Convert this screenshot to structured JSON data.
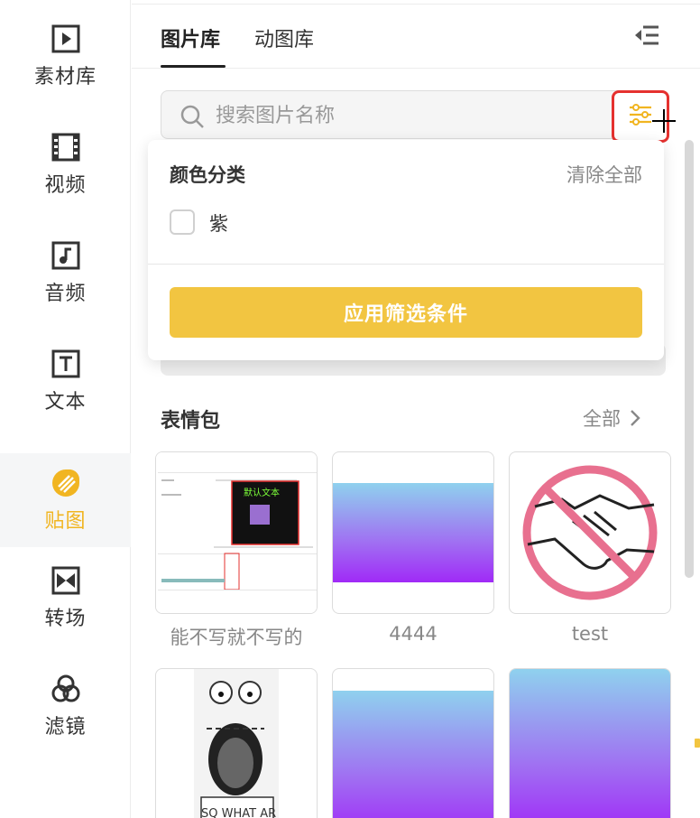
{
  "sidebar": {
    "items": [
      {
        "label": "素材库",
        "icon": "play-square-icon",
        "active": false
      },
      {
        "label": "视频",
        "icon": "film-icon",
        "active": false
      },
      {
        "label": "音频",
        "icon": "music-note-icon",
        "active": false
      },
      {
        "label": "文本",
        "icon": "text-t-icon",
        "active": false
      },
      {
        "label": "贴图",
        "icon": "sticker-icon",
        "active": true
      },
      {
        "label": "转场",
        "icon": "transition-icon",
        "active": false
      },
      {
        "label": "滤镜",
        "icon": "filter-circles-icon",
        "active": false
      }
    ],
    "active_color": "#f1b521"
  },
  "panel": {
    "tabs": [
      {
        "label": "图片库",
        "active": true
      },
      {
        "label": "动图库",
        "active": false
      }
    ],
    "search": {
      "placeholder": "搜索图片名称",
      "value": ""
    },
    "filter_dropdown": {
      "title": "颜色分类",
      "clear_label": "清除全部",
      "options": [
        {
          "label": "紫",
          "checked": false
        }
      ],
      "apply_label": "应用筛选条件",
      "apply_color": "#f2c541"
    },
    "section": {
      "title": "表情包",
      "all_label": "全部"
    },
    "cards": [
      {
        "caption": "能不写就不写的",
        "thumb": "editor-screenshot"
      },
      {
        "caption": "4444",
        "thumb": "blue-purple-gradient"
      },
      {
        "caption": "test",
        "thumb": "no-handshake-sign"
      },
      {
        "caption": "",
        "thumb": "screaming-sketch"
      },
      {
        "caption": "",
        "thumb": "blue-purple-gradient"
      },
      {
        "caption": "",
        "thumb": "blue-purple-gradient"
      }
    ],
    "thumb_texts": {
      "editor_overlay": "默认文本",
      "sketch_caption": "SQ WHAT AR"
    }
  },
  "colors": {
    "highlight_border": "#e5312f",
    "accent": "#f2c541",
    "gradient_top": "#8fd1ee",
    "gradient_bottom": "#a02af7"
  }
}
